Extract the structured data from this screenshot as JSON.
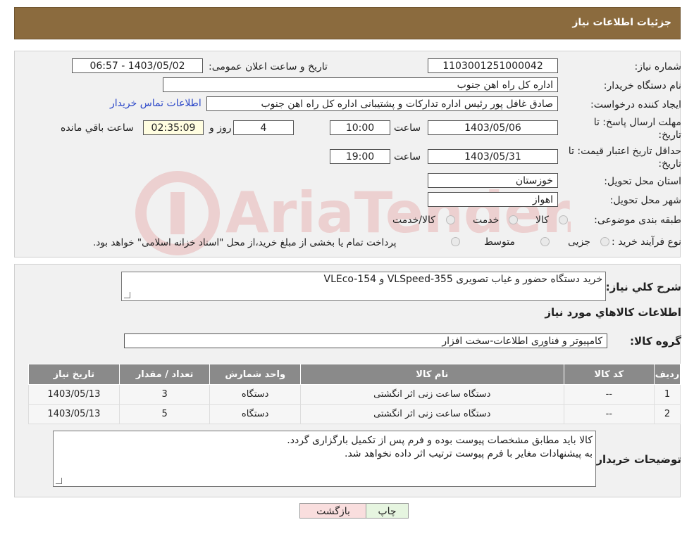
{
  "page": {
    "title": "جزئیات اطلاعات نیاز"
  },
  "form": {
    "need_number_label": "شماره نیاز:",
    "need_number": "1103001251000042",
    "announce_label": "تاریخ و ساعت اعلان عمومی:",
    "announce_value": "1403/05/02 - 06:57",
    "buyer_org_label": "نام دستگاه خریدار:",
    "buyer_org": "اداره کل راه اهن جنوب",
    "creator_label": "ایجاد کننده درخواست:",
    "creator": "صادق غافل پور رئیس اداره تدارکات و پشتیبانی اداره کل راه اهن جنوب",
    "contact_link": "اطلاعات تماس خریدار",
    "deadline_label_1": "مهلت ارسال پاسخ: تا",
    "deadline_label_2": "تاریخ:",
    "deadline_date": "1403/05/06",
    "time_label": "ساعت",
    "deadline_time": "10:00",
    "days_value": "4",
    "days_label": "روز و",
    "remaining_value": "02:35:09",
    "remaining_label": "ساعت باقي مانده",
    "validity_label_1": "حداقل تاريخ اعتبار قيمت: تا",
    "validity_label_2": "تاريخ:",
    "validity_date": "1403/05/31",
    "validity_time_label": "ساعت",
    "validity_time": "19:00",
    "province_label": "استان محل تحويل:",
    "province": "خوزستان",
    "city_label": "شهر محل تحويل:",
    "city": "اهواز",
    "category_label": "طبقه بندی موضوعی:",
    "category_options": [
      "کالا",
      "خدمت",
      "کالا/خدمت"
    ],
    "process_label": "نوع فرآیند خرید :",
    "process_options": [
      "جزیی",
      "متوسط"
    ],
    "process_note": "پرداخت تمام یا بخشی از مبلغ خرید،از محل \"اسناد خزانه اسلامی\" خواهد بود."
  },
  "details": {
    "summary_label": "شرح کلي نياز:",
    "summary": "خرید دستگاه حضور و غیاب تصویری VLSpeed-355 و VLEco-154",
    "goods_title": "اطلاعات کالاهاي مورد نياز",
    "group_label": "گروه کالا:",
    "group": "کامپیوتر و فناوری اطلاعات-سخت افزار"
  },
  "table": {
    "headers": [
      "رديف",
      "کد کالا",
      "نام کالا",
      "واحد شمارش",
      "تعداد / مقدار",
      "تاريخ نياز"
    ],
    "rows": [
      [
        "1",
        "--",
        "دستگاه ساعت زنی اثر انگشتی",
        "دستگاه",
        "3",
        "1403/05/13"
      ],
      [
        "2",
        "--",
        "دستگاه ساعت زنی اثر انگشتی",
        "دستگاه",
        "5",
        "1403/05/13"
      ]
    ]
  },
  "notes": {
    "label": "توضيحات خريدار:",
    "line1": "کالا باید مطابق مشخصات پیوست بوده و فرم پس از تکمیل بارگزاری گردد.",
    "line2": "به پیشنهادات مغایر با فرم پیوست ترتیب اثر داده نخواهد شد."
  },
  "buttons": {
    "print": "چاپ",
    "back": "بازگشت"
  },
  "watermark": {
    "text": "AriaTender.neT"
  },
  "colors": {
    "header": "#8b6b3e",
    "link": "#2a46c8",
    "back_button": "#f9dede",
    "print_button": "#e6f5e0"
  }
}
